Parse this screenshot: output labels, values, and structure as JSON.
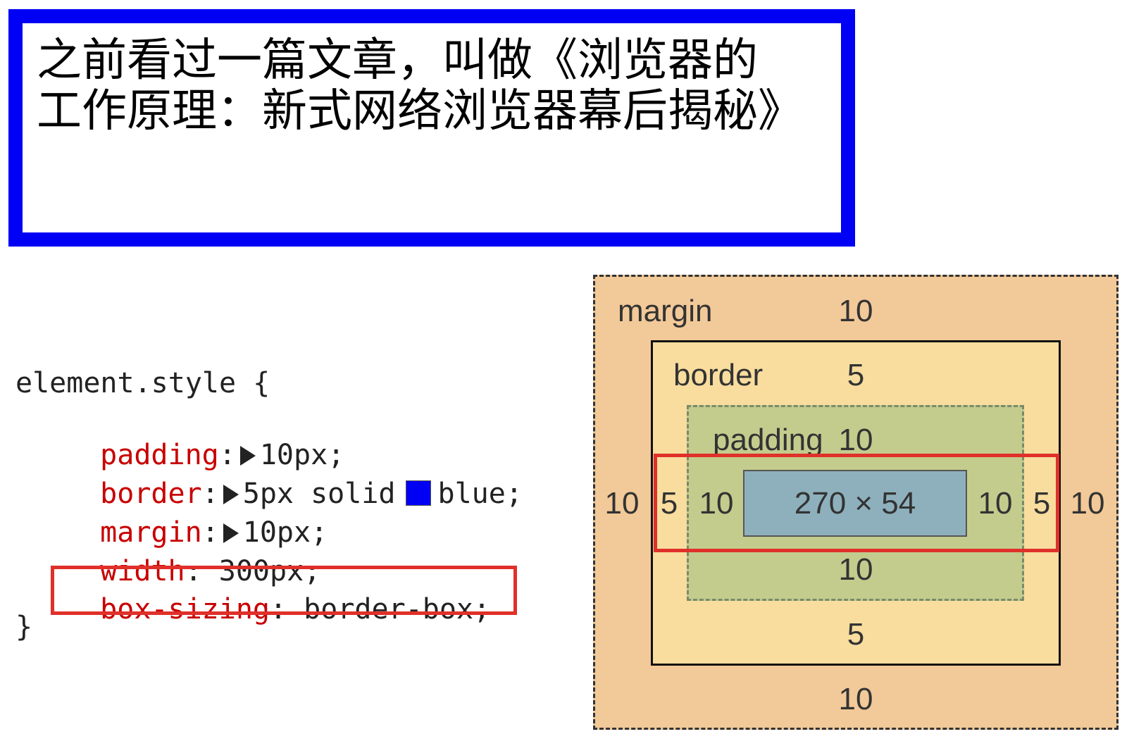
{
  "demo": {
    "text": "之前看过一篇文章，叫做《浏览器的工作原理：新式网络浏览器幕后揭秘》",
    "border_color": "#0000f5"
  },
  "styles": {
    "selector": "element.style {",
    "closing": "}",
    "declarations": [
      {
        "prop": "padding",
        "colon": ":",
        "value": "10px;",
        "expandable": true
      },
      {
        "prop": "border",
        "colon": ":",
        "value_before_swatch": "5px solid",
        "value": "blue;",
        "expandable": true,
        "swatch_color": "#0000f5"
      },
      {
        "prop": "margin",
        "colon": ":",
        "value": "10px;",
        "expandable": true
      },
      {
        "prop": "width",
        "colon": ": ",
        "value": "300px;",
        "expandable": false
      },
      {
        "prop": "box-sizing",
        "colon": ": ",
        "value": "border-box;",
        "expandable": false,
        "highlighted": true
      }
    ]
  },
  "box_model": {
    "margin": {
      "label": "margin",
      "top": "10",
      "bottom": "10",
      "left": "10",
      "right": "10"
    },
    "border": {
      "label": "border",
      "top": "5",
      "bottom": "5",
      "left": "5",
      "right": "5"
    },
    "padding": {
      "label": "padding",
      "top": "10",
      "bottom": "10",
      "left": "10",
      "right": "10"
    },
    "content": {
      "size": "270 × 54"
    },
    "colors": {
      "margin": "#f2c998",
      "border": "#f8dd9e",
      "padding": "#c3cc8d",
      "content": "#8eb0bd",
      "highlight": "#e0302a"
    }
  }
}
